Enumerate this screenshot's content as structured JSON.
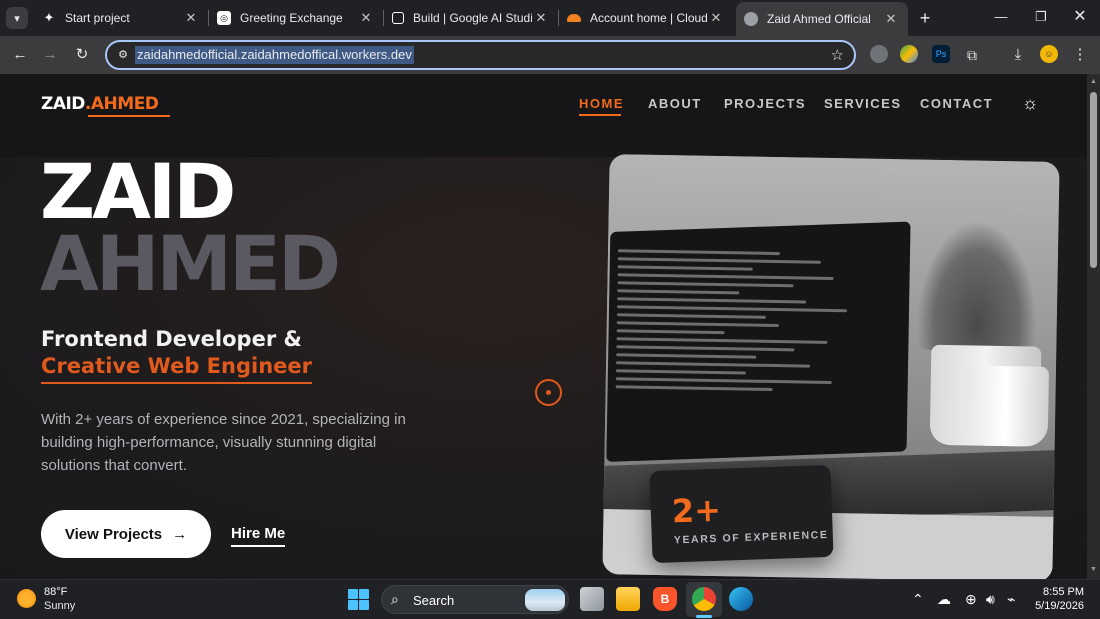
{
  "browser": {
    "tabs": [
      {
        "title": "Start project",
        "icon": "start-project-icon"
      },
      {
        "title": "Greeting Exchange",
        "icon": "chatgpt-icon"
      },
      {
        "title": "Build | Google AI Studio",
        "icon": "ai-studio-icon"
      },
      {
        "title": "Account home | Cloudfla",
        "icon": "cloudflare-icon"
      },
      {
        "title": "Zaid Ahmed Official",
        "icon": "globe-icon"
      }
    ],
    "active_tab": 4,
    "url": "zaidahmedofficial.zaidahmedoffical.workers.dev"
  },
  "site": {
    "logo_first": "ZAID",
    "logo_dot": ".",
    "logo_last": "AHMED",
    "nav": [
      "HOME",
      "ABOUT",
      "PROJECTS",
      "SERVICES",
      "CONTACT"
    ],
    "active_nav": "HOME",
    "hero": {
      "name_line1": "ZAID",
      "name_line2": "AHMED",
      "role_line1": "Frontend Developer &",
      "role_line2": "Creative Web Engineer",
      "description": "With 2+ years of experience since 2021, specializing in building high-performance, visually stunning digital solutions that convert.",
      "primary_button": "View Projects",
      "secondary_link": "Hire Me"
    },
    "experience_card": {
      "value": "2+",
      "label": "YEARS OF EXPERIENCE"
    },
    "accent_color": "#f26b1d"
  },
  "taskbar": {
    "weather_temp": "88°F",
    "weather_cond": "Sunny",
    "search_label": "Search",
    "time": "8:55 PM",
    "date": "5/19/2026"
  }
}
